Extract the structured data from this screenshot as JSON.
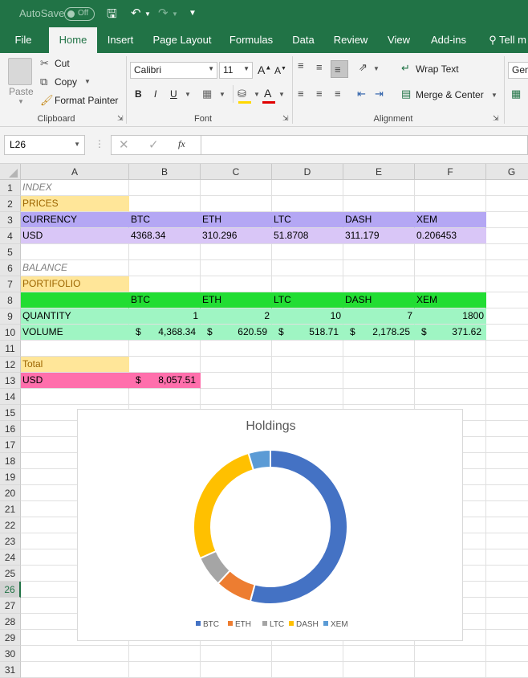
{
  "titlebar": {
    "autosave_label": "AutoSave",
    "autosave_state": "Off"
  },
  "menu": {
    "tabs": [
      "File",
      "Home",
      "Insert",
      "Page Layout",
      "Formulas",
      "Data",
      "Review",
      "View",
      "Add-ins",
      "Tell m"
    ],
    "active": "Home"
  },
  "ribbon": {
    "clipboard": {
      "paste": "Paste",
      "cut": "Cut",
      "copy": "Copy",
      "format_painter": "Format Painter",
      "label": "Clipboard"
    },
    "font": {
      "name": "Calibri",
      "size": "11",
      "label": "Font",
      "bold": "B",
      "italic": "I",
      "underline": "U"
    },
    "alignment": {
      "wrap_text": "Wrap Text",
      "merge_center": "Merge & Center",
      "label": "Alignment"
    },
    "number": {
      "format": "Gen"
    }
  },
  "formula_bar": {
    "name_box": "L26",
    "fx": "fx",
    "formula": ""
  },
  "columns": [
    "A",
    "B",
    "C",
    "D",
    "E",
    "F",
    "G"
  ],
  "rows": [
    "1",
    "2",
    "3",
    "4",
    "5",
    "6",
    "7",
    "8",
    "9",
    "10",
    "11",
    "12",
    "13",
    "14",
    "15",
    "16",
    "17",
    "18",
    "19",
    "20",
    "21",
    "22",
    "23",
    "24",
    "25",
    "26",
    "27",
    "28",
    "29",
    "30",
    "31"
  ],
  "selected_row": "26",
  "cells": {
    "A1": "INDEX",
    "A2": "PRICES",
    "A3": "CURRENCY",
    "B3": "BTC",
    "C3": "ETH",
    "D3": "LTC",
    "E3": "DASH",
    "F3": "XEM",
    "A4": "USD",
    "B4": "4368.34",
    "C4": "310.296",
    "D4": "51.8708",
    "E4": "311.179",
    "F4": "0.206453",
    "A6": "BALANCE",
    "A7": "PORTIFOLIO",
    "B8": "BTC",
    "C8": "ETH",
    "D8": "LTC",
    "E8": "DASH",
    "F8": "XEM",
    "A9": "QUANTITY",
    "B9": "1",
    "C9": "2",
    "D9": "10",
    "E9": "7",
    "F9": "1800",
    "A10": "VOLUME",
    "B10": "4,368.34",
    "C10": "620.59",
    "D10": "518.71",
    "E10": "2,178.25",
    "F10": "371.62",
    "A12": "Total",
    "A13": "USD",
    "B13": "8,057.51"
  },
  "currency_symbol": "$",
  "colors": {
    "ribbon_green": "#217346",
    "prices": "#ffe699",
    "currency_hdr": "#b4a7f4",
    "usd_row": "#d9c6f7",
    "balance_hdr": "#22dd33",
    "qty_rows": "#9ff5c3",
    "total_usd": "#ff6fac"
  },
  "chart_data": {
    "type": "pie",
    "title": "Holdings",
    "categories": [
      "BTC",
      "ETH",
      "LTC",
      "DASH",
      "XEM"
    ],
    "values": [
      4368.34,
      620.59,
      518.71,
      2178.25,
      371.62
    ],
    "colors": [
      "#4472c4",
      "#ed7d31",
      "#a5a5a5",
      "#ffc000",
      "#5b9bd5"
    ],
    "style": "doughnut",
    "legend": "bottom"
  }
}
